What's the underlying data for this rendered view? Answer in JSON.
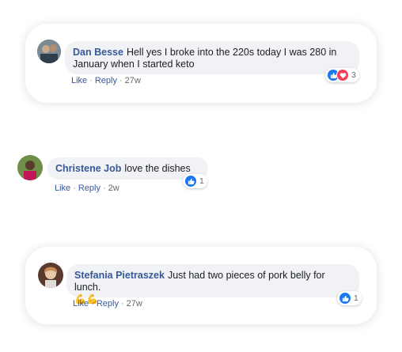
{
  "comments": [
    {
      "author": "Dan Besse",
      "text": "Hell yes I broke into the 220s today I was 280 in January when I started keto",
      "actions": {
        "like": "Like",
        "reply": "Reply",
        "time": "27w"
      },
      "reactions": {
        "types": [
          "like-icon",
          "love-icon"
        ],
        "count": "3"
      },
      "avatar_colors": [
        "#8a7a6a",
        "#3b4a5a"
      ]
    },
    {
      "author": "Christene Job",
      "text": "love the dishes",
      "actions": {
        "like": "Like",
        "reply": "Reply",
        "time": "2w"
      },
      "reactions": {
        "types": [
          "like-icon"
        ],
        "count": "1"
      },
      "avatar_colors": [
        "#5a8a3a",
        "#c2185b"
      ]
    },
    {
      "author": "Stefania Pietraszek",
      "text": "Just had two pieces of pork belly for lunch.",
      "emojis": "💪💪",
      "actions": {
        "like": "Like",
        "reply": "Reply",
        "time": "27w"
      },
      "reactions": {
        "types": [
          "like-icon"
        ],
        "count": "1"
      },
      "avatar_colors": [
        "#6b4a3a",
        "#e8c8a8"
      ]
    }
  ],
  "colors": {
    "author": "#385898",
    "bubble": "#f0f2f5",
    "like": "#1877f2",
    "love": "#f33e58"
  }
}
